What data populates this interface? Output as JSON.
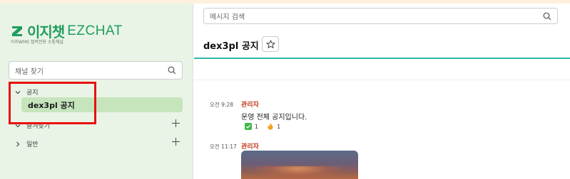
{
  "brand": {
    "logo_korean": "이지챗",
    "logo_english": "EZCHAT",
    "tagline": "이지WMS 협력전용 소통채널",
    "color": "#1f9d5d"
  },
  "sidebar": {
    "search_placeholder": "채널 찾기",
    "groups": [
      {
        "label": "공지",
        "expanded": true,
        "channels": [
          {
            "label": "dex3pl 공지",
            "selected": true
          }
        ]
      },
      {
        "label": "즐겨찾기",
        "expanded": true,
        "channels": []
      },
      {
        "label": "일반",
        "expanded": false,
        "channels": []
      }
    ]
  },
  "main": {
    "search_placeholder": "메시지 검색",
    "channel_title": "dex3pl 공지",
    "messages": [
      {
        "time": "오전 9:28",
        "author": "관리자",
        "text": "운영 전체 공지입니다.",
        "reactions": [
          {
            "icon": "check-icon",
            "count": "1"
          },
          {
            "icon": "fire-icon",
            "count": "1"
          }
        ]
      },
      {
        "time": "오전 11:17",
        "author": "관리자",
        "attachment": "image"
      }
    ]
  },
  "colors": {
    "sidebar_bg": "#e9f4e6",
    "selected_channel_bg": "#c6e5bc",
    "header_divider": "#2eb8a8",
    "author": "#c03a1a",
    "highlight": "#e8110f"
  }
}
